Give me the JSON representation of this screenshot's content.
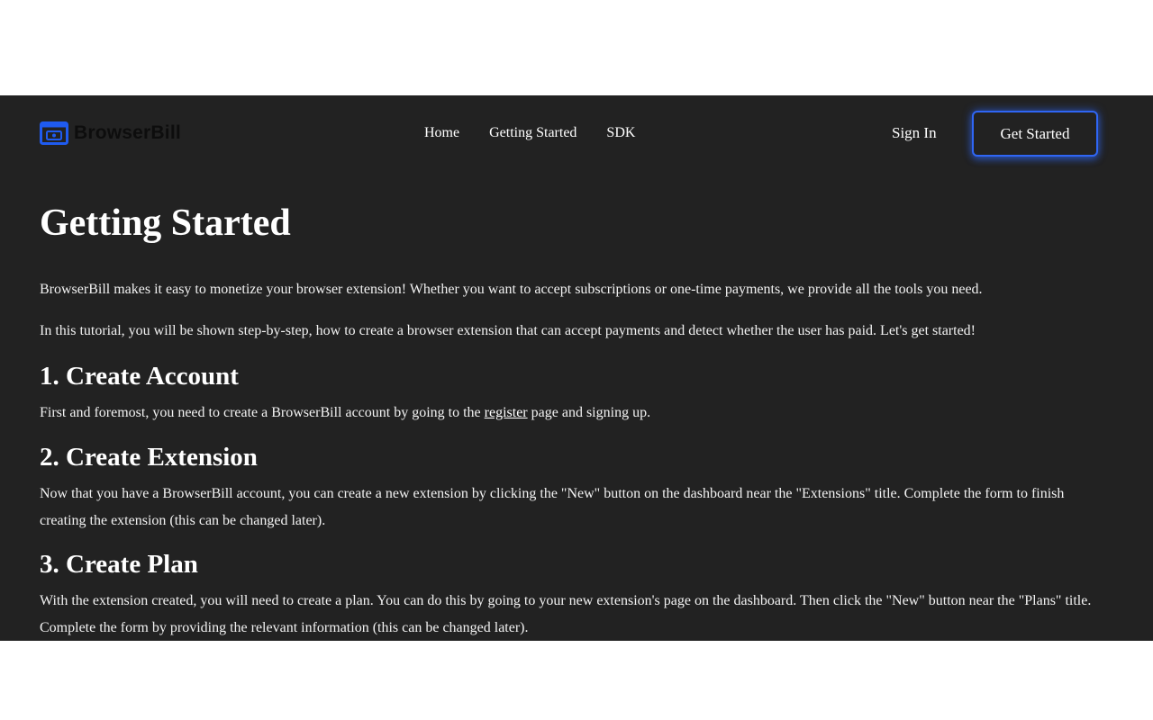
{
  "nav": {
    "brand": "BrowserBill",
    "links": [
      "Home",
      "Getting Started",
      "SDK"
    ],
    "sign_in": "Sign In",
    "cta": "Get Started"
  },
  "page": {
    "title": "Getting Started",
    "intro": [
      "BrowserBill makes it easy to monetize your browser extension! Whether you want to accept subscriptions or one-time payments, we provide all the tools you need.",
      "In this tutorial, you will be shown step-by-step, how to create a browser extension that can accept payments and detect whether the user has paid. Let's get started!"
    ],
    "sections": [
      {
        "heading": "1. Create Account",
        "text_before": "First and foremost, you need to create a BrowserBill account by going to the ",
        "link": "register",
        "text_after": " page and signing up."
      },
      {
        "heading": "2. Create Extension",
        "text": "Now that you have a BrowserBill account, you can create a new extension by clicking the \"New\" button on the dashboard near the \"Extensions\" title. Complete the form to finish creating the extension (this can be changed later)."
      },
      {
        "heading": "3. Create Plan",
        "text": "With the extension created, you will need to create a plan. You can do this by going to your new extension's page on the dashboard. Then click the \"New\" button near the \"Plans\" title. Complete the form by providing the relevant information (this can be changed later)."
      }
    ]
  },
  "colors": {
    "background": "#222222",
    "accent": "#2f66f5",
    "text": "#ffffff",
    "outer": "#ffffff"
  },
  "icons": {
    "brand": "browser-billing-icon"
  }
}
